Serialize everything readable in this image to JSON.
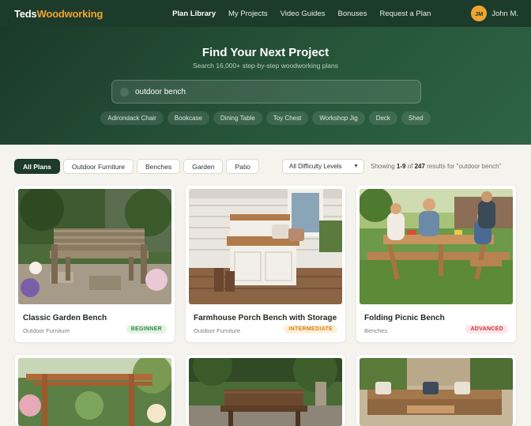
{
  "nav": {
    "logo_prefix": "Teds",
    "logo_suffix": "Woodworking",
    "links": [
      "Plan Library",
      "My Projects",
      "Video Guides",
      "Bonuses",
      "Request a Plan"
    ],
    "user_initials": "JM",
    "user_name": "John M."
  },
  "hero": {
    "title": "Find Your Next Project",
    "subtitle": "Search 16,000+ step-by-step woodworking plans",
    "search_value": "outdoor bench",
    "chips": [
      "Adirondack Chair",
      "Bookcase",
      "Dining Table",
      "Toy Chest",
      "Workshop Jig",
      "Deck",
      "Shed"
    ]
  },
  "filters": {
    "tabs": [
      "All Plans",
      "Outdoor Furniture",
      "Benches",
      "Garden",
      "Patio"
    ],
    "difficulty": "All Difficulty Levels",
    "results_prefix": "Showing ",
    "results_range": "1-9",
    "results_mid": " of ",
    "results_total": "247",
    "results_suffix": " results for \"outdoor bench\""
  },
  "cards": [
    {
      "title": "Classic Garden Bench",
      "category": "Outdoor Furniture",
      "level": "BEGINNER"
    },
    {
      "title": "Farmhouse Porch Bench with Storage",
      "category": "Outdoor Furniture",
      "level": "INTERMEDIATE"
    },
    {
      "title": "Folding Picnic Bench",
      "category": "Benches",
      "level": "ADVANCED"
    }
  ],
  "colors": {
    "brand": "#1d3b2b",
    "accent": "#f0a530"
  }
}
